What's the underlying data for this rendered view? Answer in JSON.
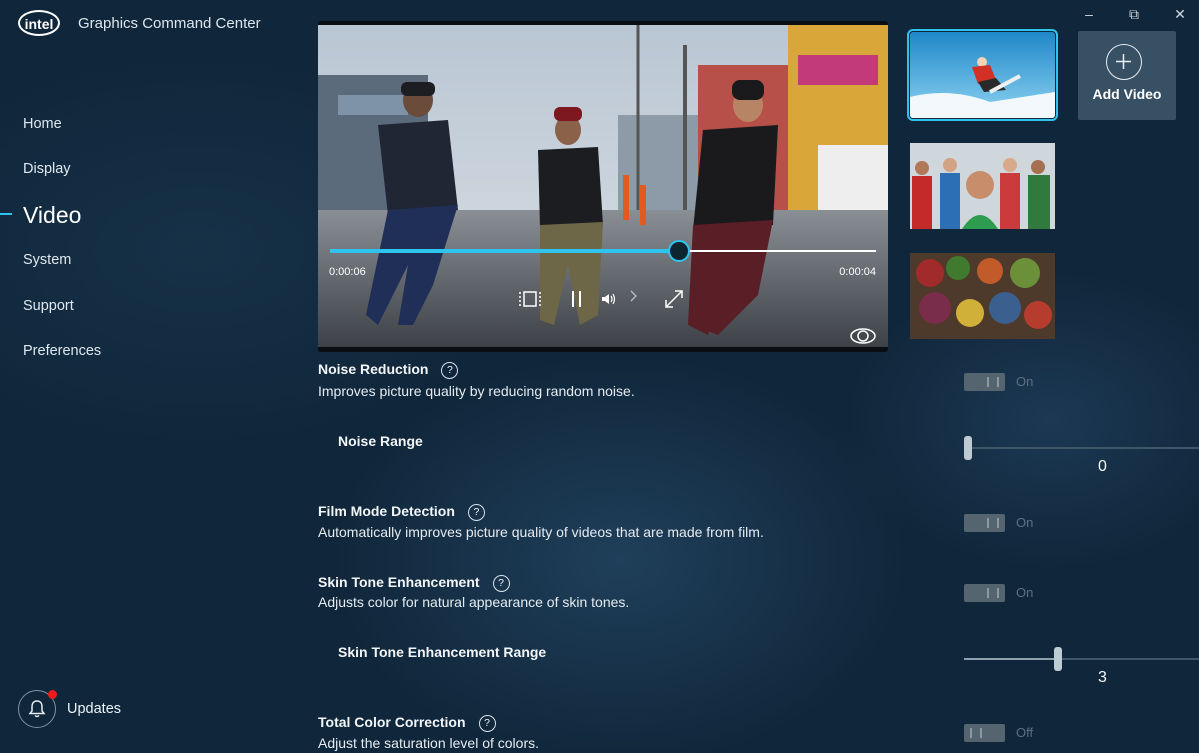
{
  "app": {
    "logo": "intel",
    "title": "Graphics Command Center"
  },
  "nav": [
    {
      "label": "Home"
    },
    {
      "label": "Display"
    },
    {
      "label": "Video"
    },
    {
      "label": "System"
    },
    {
      "label": "Support"
    },
    {
      "label": "Preferences"
    }
  ],
  "nav_active": "Video",
  "updates": {
    "label": "Updates",
    "has_notification": true
  },
  "window_controls": {
    "minimize": "–",
    "restore": "⧉",
    "close": "✕"
  },
  "player": {
    "elapsed": "0:00:06",
    "remaining": "0:00:04",
    "progress": 0.64,
    "icons": [
      "compare-icon",
      "pause-icon",
      "volume-icon",
      "chevron-right-icon",
      "fullscreen-icon",
      "eye-icon"
    ]
  },
  "thumbnails": [
    {
      "name": "snowboarder",
      "selected": true
    },
    {
      "name": "group-portrait",
      "selected": false
    },
    {
      "name": "market-produce",
      "selected": false
    }
  ],
  "add_video": {
    "label": "Add Video"
  },
  "settings": {
    "noise_reduction": {
      "title": "Noise Reduction",
      "description": "Improves picture quality by reducing random noise.",
      "state": "On"
    },
    "noise_range": {
      "label": "Noise Range",
      "value": "0"
    },
    "film_mode": {
      "title": "Film Mode Detection",
      "description": "Automatically improves picture quality of videos that are made from film.",
      "state": "On"
    },
    "skin_tone": {
      "title": "Skin Tone Enhancement",
      "description": "Adjusts color for natural appearance of skin tones.",
      "state": "On"
    },
    "skin_tone_range": {
      "label": "Skin Tone Enhancement Range",
      "value": "3"
    },
    "total_color": {
      "title": "Total Color Correction",
      "description": "Adjust the saturation level of colors.",
      "state": "Off"
    }
  },
  "colors": {
    "accent": "#2ec4ee",
    "background": "#10263a",
    "notification": "#f01b1b"
  }
}
